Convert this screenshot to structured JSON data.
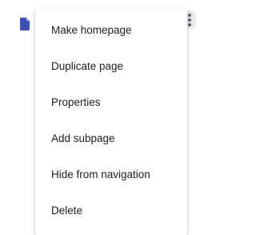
{
  "page_icon": {
    "name": "page-icon",
    "color": "#3f51b5"
  },
  "kebab_icon": {
    "name": "more-vert-icon"
  },
  "menu": {
    "items": [
      {
        "label": "Make homepage"
      },
      {
        "label": "Duplicate page"
      },
      {
        "label": "Properties"
      },
      {
        "label": "Add subpage"
      },
      {
        "label": "Hide from navigation"
      },
      {
        "label": "Delete"
      }
    ]
  }
}
